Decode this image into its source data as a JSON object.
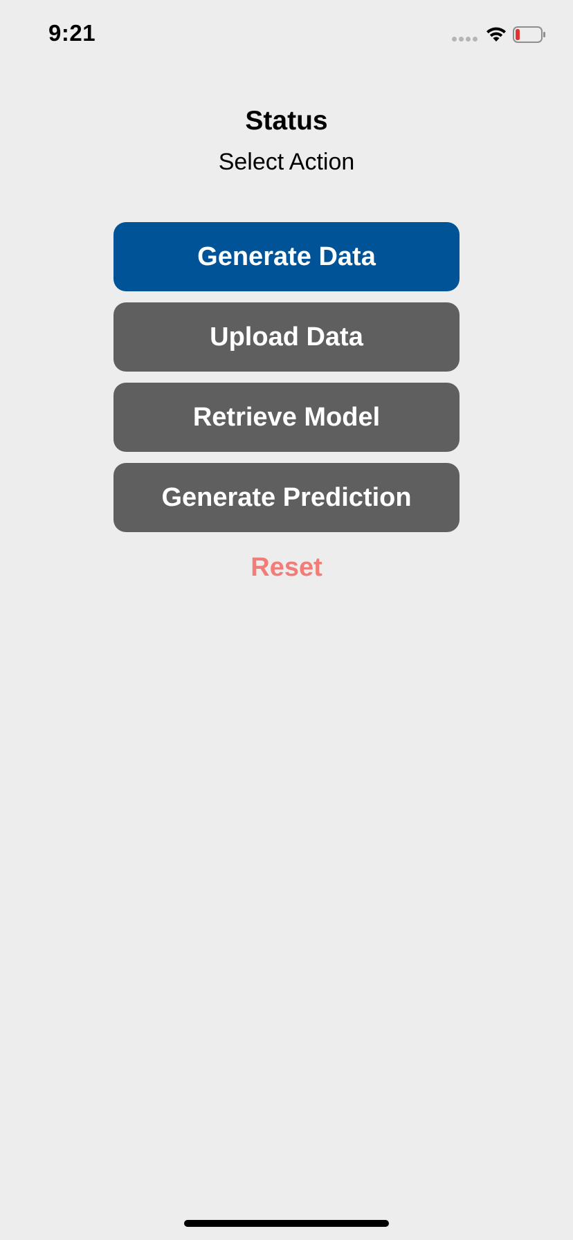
{
  "status_bar": {
    "time": "9:21",
    "wifi_icon": "wifi-icon",
    "battery_icon": "battery-low-icon",
    "battery_level_fraction": 0.1,
    "signal_icon": "cellular-signal-icon"
  },
  "header": {
    "title": "Status",
    "subtitle": "Select Action"
  },
  "actions": {
    "generate_data": "Generate Data",
    "upload_data": "Upload Data",
    "retrieve_model": "Retrieve Model",
    "generate_prediction": "Generate Prediction",
    "reset": "Reset"
  },
  "colors": {
    "background": "#ededed",
    "primary_button": "#005396",
    "secondary_button": "#5f5f5f",
    "reset_text": "#f27c78",
    "battery_low": "#e0332f"
  }
}
